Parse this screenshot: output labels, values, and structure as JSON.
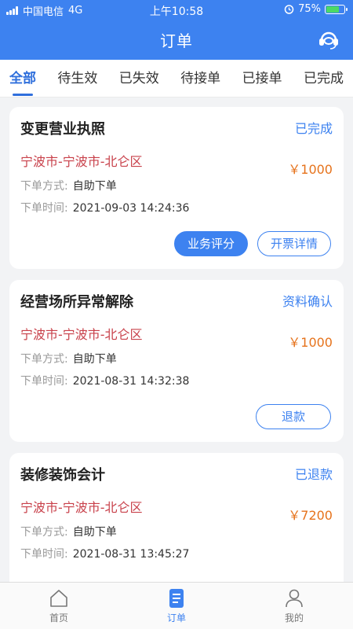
{
  "status_bar": {
    "carrier": "中国电信",
    "network": "4G",
    "time": "上午10:58",
    "battery": "75%",
    "battery_level": 0.75
  },
  "header": {
    "title": "订单",
    "service_icon": "headset-icon"
  },
  "tabs": [
    {
      "label": "全部",
      "active": true
    },
    {
      "label": "待生效"
    },
    {
      "label": "已失效"
    },
    {
      "label": "待接单"
    },
    {
      "label": "已接单"
    },
    {
      "label": "已完成"
    }
  ],
  "orders": [
    {
      "name": "变更营业执照",
      "status": "已完成",
      "region": "宁波市-宁波市-北仑区",
      "price": "￥1000",
      "method_label": "下单方式:",
      "method": "自助下单",
      "time_label": "下单时间:",
      "time": "2021-09-03 14:24:36",
      "actions": [
        "业务评分",
        "开票详情"
      ]
    },
    {
      "name": "经营场所异常解除",
      "status": "资料确认",
      "region": "宁波市-宁波市-北仑区",
      "price": "￥1000",
      "method_label": "下单方式:",
      "method": "自助下单",
      "time_label": "下单时间:",
      "time": "2021-08-31 14:32:38",
      "actions": [
        "退款"
      ]
    },
    {
      "name": "装修装饰会计",
      "status": "已退款",
      "region": "宁波市-宁波市-北仑区",
      "price": "￥7200",
      "method_label": "下单方式:",
      "method": "自助下单",
      "time_label": "下单时间:",
      "time": "2021-08-31 13:45:27",
      "actions": []
    }
  ],
  "bottom_nav": [
    {
      "label": "首页",
      "icon": "home-icon"
    },
    {
      "label": "订单",
      "icon": "order-icon",
      "active": true
    },
    {
      "label": "我的",
      "icon": "user-icon"
    }
  ],
  "colors": {
    "primary": "#3d82f0",
    "region": "#c8404a",
    "price": "#e6731c"
  }
}
